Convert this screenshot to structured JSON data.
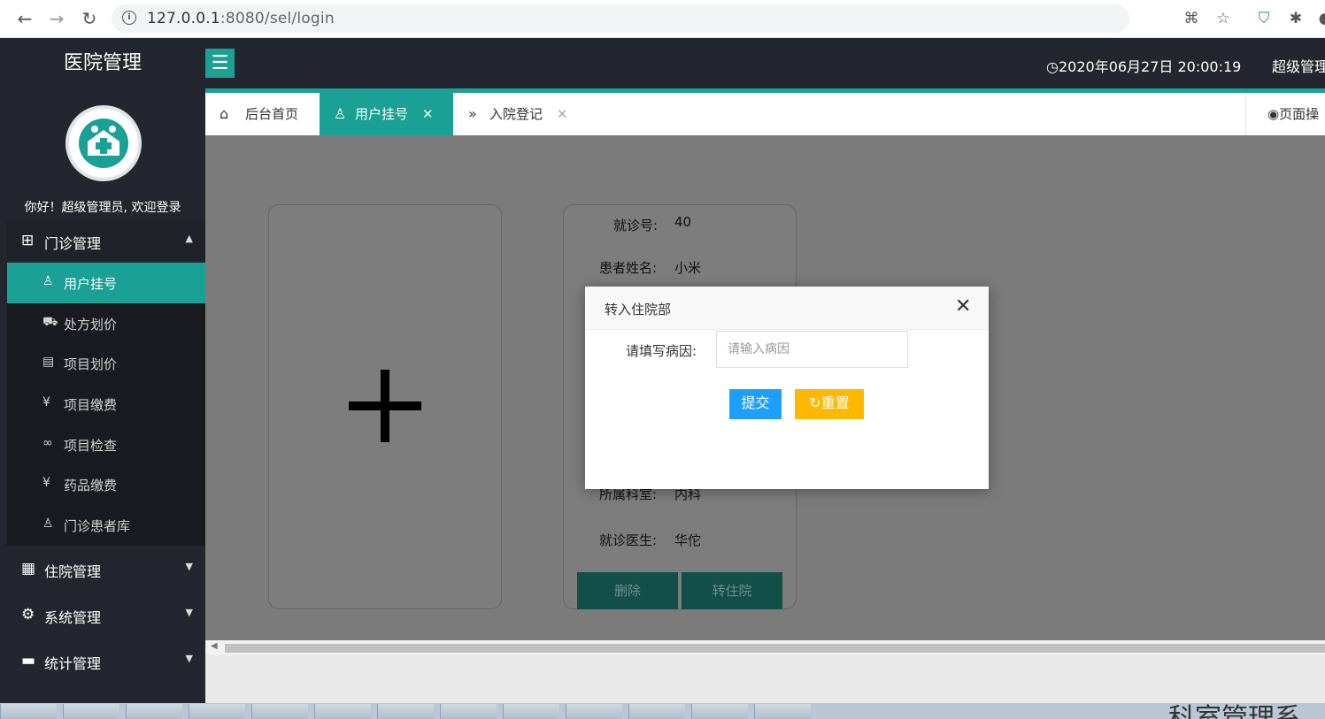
{
  "browser": {
    "url_prefix": "127.0.0.1",
    "url_rest": ":8080/sel/login"
  },
  "header": {
    "logo": "医院管理",
    "datetime": "2020年06月27日 20:00:19",
    "user": "超级管理"
  },
  "sidebar": {
    "welcome": "你好！超级管理员, 欢迎登录",
    "groups": [
      {
        "label": "门诊管理",
        "icon": "grid-icon",
        "expanded": true
      },
      {
        "label": "住院管理",
        "icon": "building-icon",
        "expanded": false
      },
      {
        "label": "系统管理",
        "icon": "gear-icon",
        "expanded": false
      },
      {
        "label": "统计管理",
        "icon": "monitor-icon",
        "expanded": false
      }
    ],
    "items": [
      {
        "label": "用户挂号",
        "icon": "user-icon"
      },
      {
        "label": "处方划价",
        "icon": "cart-icon"
      },
      {
        "label": "项目划价",
        "icon": "document-icon"
      },
      {
        "label": "项目缴费",
        "icon": "yen-icon"
      },
      {
        "label": "项目检查",
        "icon": "link-icon"
      },
      {
        "label": "药品缴费",
        "icon": "yen-icon"
      },
      {
        "label": "门诊患者库",
        "icon": "user-icon"
      }
    ]
  },
  "tabs": [
    {
      "label": "后台首页",
      "icon": "home-icon"
    },
    {
      "label": "用户挂号",
      "icon": "user-icon"
    },
    {
      "label": "入院登记",
      "icon": "chevrons-icon"
    }
  ],
  "page_ops": "页面操",
  "patient": {
    "visit_no_label": "就诊号:",
    "visit_no": "40",
    "name_label": "患者姓名:",
    "name": "小米",
    "dept_label": "所属科室:",
    "dept": "内科",
    "doctor_label": "就诊医生:",
    "doctor": "华佗",
    "delete_btn": "删除",
    "transfer_btn": "转住院"
  },
  "dialog": {
    "title": "转入住院部",
    "label": "请填写病因:",
    "placeholder": "请输入病因",
    "submit": "提交",
    "reset": "重置"
  },
  "desktop": {
    "wallpaper_text": "科室管理系"
  },
  "colors": {
    "header": "#23262e",
    "accent": "#1aa094",
    "submit": "#1e9fff",
    "reset": "#ffb800"
  }
}
